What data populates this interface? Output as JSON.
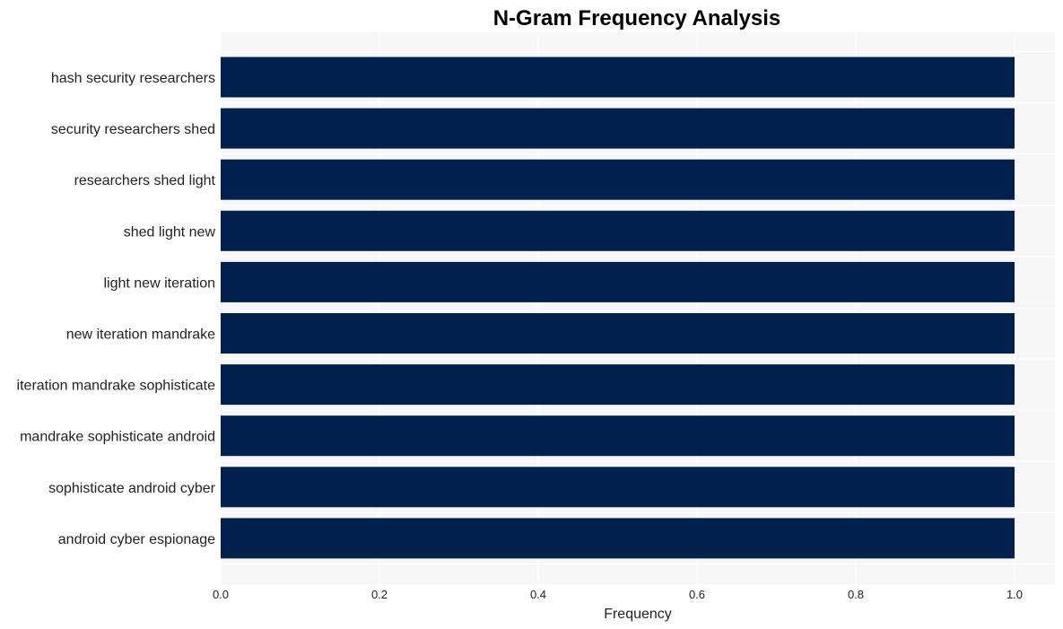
{
  "chart_data": {
    "type": "bar",
    "orientation": "horizontal",
    "title": "N-Gram Frequency Analysis",
    "xlabel": "Frequency",
    "ylabel": "",
    "categories": [
      "hash security researchers",
      "security researchers shed",
      "researchers shed light",
      "shed light new",
      "light new iteration",
      "new iteration mandrake",
      "iteration mandrake sophisticate",
      "mandrake sophisticate android",
      "sophisticate android cyber",
      "android cyber espionage"
    ],
    "values": [
      1,
      1,
      1,
      1,
      1,
      1,
      1,
      1,
      1,
      1
    ],
    "xlim": [
      0,
      1.05
    ],
    "xticks": [
      0.0,
      0.2,
      0.4,
      0.6,
      0.8,
      1.0
    ],
    "xtick_labels": [
      "0.0",
      "0.2",
      "0.4",
      "0.6",
      "0.8",
      "1.0"
    ],
    "grid": true,
    "legend": "none",
    "colors": {
      "bar": "#00214e",
      "plot_background": "#f7f7f7",
      "grid": "#ffffff"
    }
  }
}
